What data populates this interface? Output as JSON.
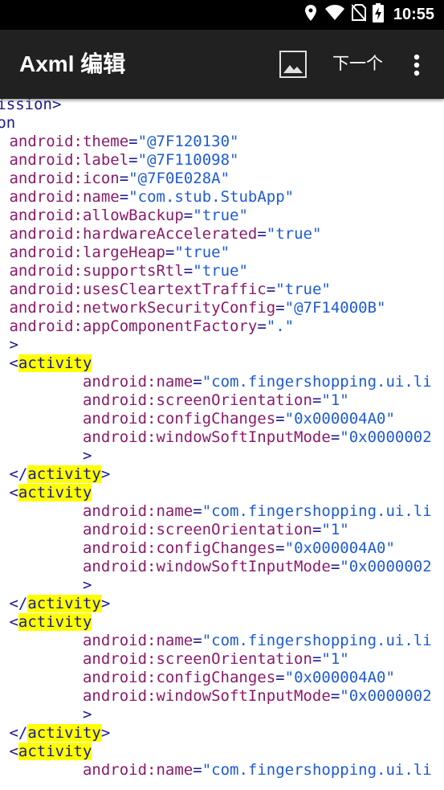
{
  "status_bar": {
    "time": "10:55",
    "icons": [
      "location-icon",
      "wifi-icon",
      "no-sim-icon",
      "battery-charging-icon"
    ]
  },
  "app_bar": {
    "title": "Axml 编辑",
    "image_button_icon": "image-icon",
    "next_label": "下一个",
    "more_icon": "more-vert-icon"
  },
  "editor": {
    "highlight_term": "activity",
    "colors": {
      "punctuation": "#1a1a8c",
      "attribute": "#8b1a6b",
      "value": "#1e5bd6",
      "highlight": "#ffff00"
    },
    "lines": [
      {
        "text": "ermission>",
        "cut_left": true
      },
      {
        "text": "ation",
        "cut_left": true
      },
      {
        "indent": 0,
        "attr": "android:theme",
        "value": "\"@7F120130\""
      },
      {
        "indent": 0,
        "attr": "android:label",
        "value": "\"@7F110098\""
      },
      {
        "indent": 0,
        "attr": "android:icon",
        "value": "\"@7F0E028A\""
      },
      {
        "indent": 0,
        "attr": "android:name",
        "value": "\"com.stub.StubApp\""
      },
      {
        "indent": 0,
        "attr": "android:allowBackup",
        "value": "\"true\""
      },
      {
        "indent": 0,
        "attr": "android:hardwareAccelerated",
        "value": "\"true\""
      },
      {
        "indent": 0,
        "attr": "android:largeHeap",
        "value": "\"true\""
      },
      {
        "indent": 0,
        "attr": "android:supportsRtl",
        "value": "\"true\""
      },
      {
        "indent": 0,
        "attr": "android:usesCleartextTraffic",
        "value": "\"true\""
      },
      {
        "indent": 0,
        "attr": "android:networkSecurityConfig",
        "value": "\"@7F14000B\""
      },
      {
        "indent": 0,
        "attr": "android:appComponentFactory",
        "value": "\".\""
      },
      {
        "punct": ">"
      },
      {
        "open_tag": "activity"
      },
      {
        "indent": 8,
        "attr": "android:name",
        "value": "\"com.fingershopping.ui.li"
      },
      {
        "indent": 8,
        "attr": "android:screenOrientation",
        "value": "\"1\""
      },
      {
        "indent": 8,
        "attr": "android:configChanges",
        "value": "\"0x000004A0\""
      },
      {
        "indent": 8,
        "attr": "android:windowSoftInputMode",
        "value": "\"0x0000002"
      },
      {
        "indent": 8,
        "punct": ">"
      },
      {
        "close_tag": "activity"
      },
      {
        "open_tag": "activity"
      },
      {
        "indent": 8,
        "attr": "android:name",
        "value": "\"com.fingershopping.ui.li"
      },
      {
        "indent": 8,
        "attr": "android:screenOrientation",
        "value": "\"1\""
      },
      {
        "indent": 8,
        "attr": "android:configChanges",
        "value": "\"0x000004A0\""
      },
      {
        "indent": 8,
        "attr": "android:windowSoftInputMode",
        "value": "\"0x0000002"
      },
      {
        "indent": 8,
        "punct": ">"
      },
      {
        "close_tag": "activity"
      },
      {
        "open_tag": "activity"
      },
      {
        "indent": 8,
        "attr": "android:name",
        "value": "\"com.fingershopping.ui.li"
      },
      {
        "indent": 8,
        "attr": "android:screenOrientation",
        "value": "\"1\""
      },
      {
        "indent": 8,
        "attr": "android:configChanges",
        "value": "\"0x000004A0\""
      },
      {
        "indent": 8,
        "attr": "android:windowSoftInputMode",
        "value": "\"0x0000002"
      },
      {
        "indent": 8,
        "punct": ">"
      },
      {
        "close_tag": "activity"
      },
      {
        "open_tag": "activity"
      },
      {
        "indent": 8,
        "attr": "android:name",
        "value": "\"com.fingershopping.ui.li"
      }
    ]
  }
}
